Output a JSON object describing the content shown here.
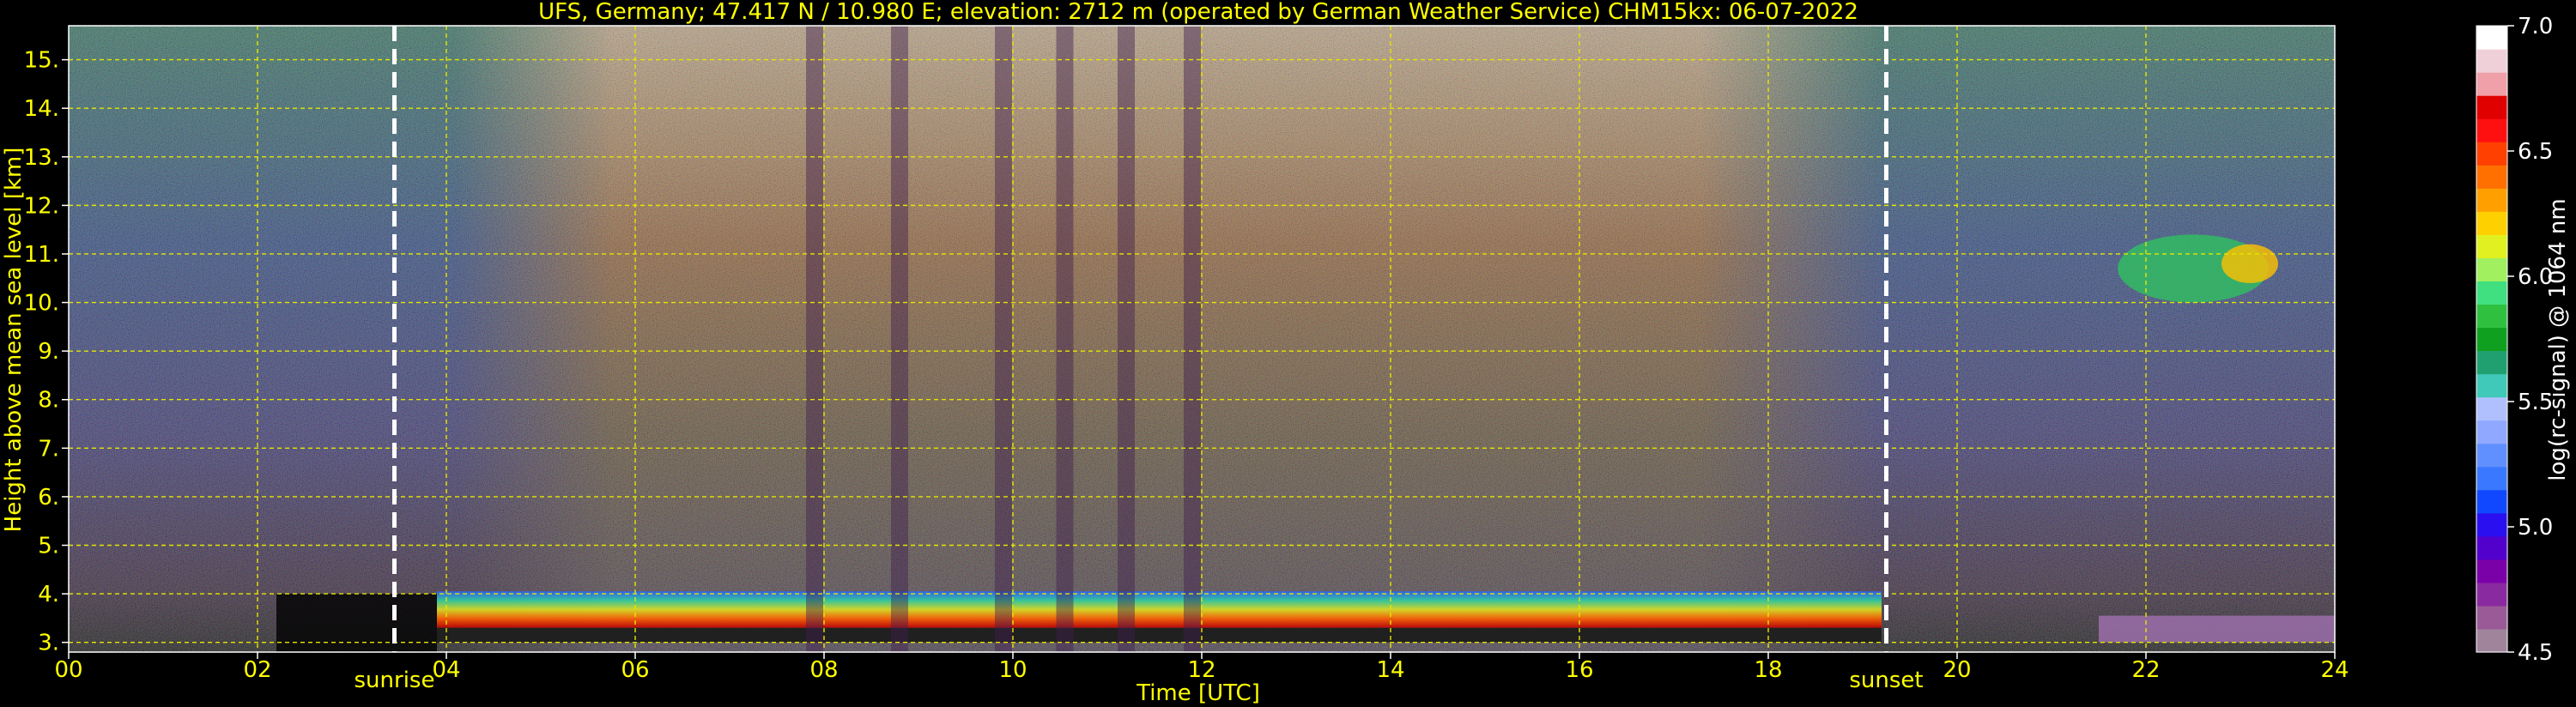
{
  "chart_data": {
    "type": "heatmap",
    "title": "UFS, Germany; 47.417 N / 10.980 E; elevation: 2712 m  (operated by German Weather Service)    CHM15kx: 06-07-2022",
    "xlabel": "Time [UTC]",
    "ylabel": "Height above mean sea level [km]",
    "xlim": [
      0,
      24
    ],
    "ylim": [
      2.8,
      15.7
    ],
    "x_ticks": [
      0,
      2,
      4,
      6,
      8,
      10,
      12,
      14,
      16,
      18,
      20,
      22,
      24
    ],
    "x_tick_labels": [
      "00",
      "02",
      "04",
      "06",
      "08",
      "10",
      "12",
      "14",
      "16",
      "18",
      "20",
      "22",
      "24"
    ],
    "y_ticks": [
      3,
      4,
      5,
      6,
      7,
      8,
      9,
      10,
      11,
      12,
      13,
      14,
      15
    ],
    "y_tick_labels": [
      "3.",
      "4.",
      "5.",
      "6.",
      "7.",
      "8.",
      "9.",
      "10.",
      "11.",
      "12.",
      "13.",
      "14.",
      "15."
    ],
    "grid": true,
    "events": [
      {
        "label": "sunrise",
        "time": 3.45
      },
      {
        "label": "sunset",
        "time": 19.25
      }
    ],
    "colorbar": {
      "label": "log(rc-signal) @ 1064 nm",
      "range": [
        4.5,
        7.0
      ],
      "ticks": [
        4.5,
        5.0,
        5.5,
        6.0,
        6.5,
        7.0
      ],
      "tick_labels": [
        "4.5",
        "5.0",
        "5.5",
        "6.0",
        "6.5",
        "7.0"
      ],
      "colors": [
        "#a0849c",
        "#9a5a98",
        "#8a2aa0",
        "#7a00a8",
        "#5200cc",
        "#2a10f0",
        "#1048ff",
        "#3a78ff",
        "#6090ff",
        "#90a8ff",
        "#b0c0ff",
        "#40c8b8",
        "#20a070",
        "#10a020",
        "#30c040",
        "#40e080",
        "#a0f060",
        "#e0f020",
        "#ffd000",
        "#ffa000",
        "#ff7000",
        "#ff4000",
        "#ff1010",
        "#e00000",
        "#f0a0a8",
        "#f0d0d8",
        "#ffffff"
      ]
    }
  }
}
